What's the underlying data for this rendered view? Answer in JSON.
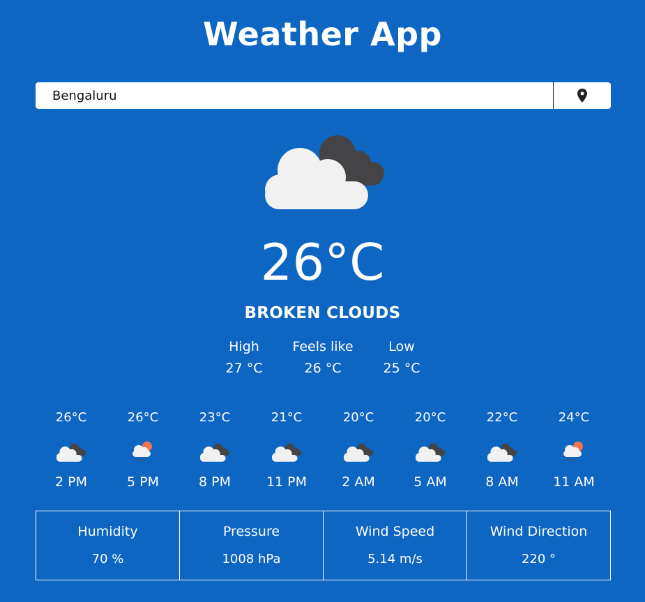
{
  "app": {
    "title": "Weather App"
  },
  "search": {
    "value": "Bengaluru"
  },
  "current": {
    "icon": "broken-clouds-icon",
    "temperature": "26°C",
    "description": "BROKEN CLOUDS",
    "stats": [
      {
        "label": "High",
        "value": "27 °C"
      },
      {
        "label": "Feels like",
        "value": "26 °C"
      },
      {
        "label": "Low",
        "value": "25 °C"
      }
    ]
  },
  "hourly": [
    {
      "temp": "26°C",
      "time": "2 PM",
      "icon": "broken-clouds-icon"
    },
    {
      "temp": "26°C",
      "time": "5 PM",
      "icon": "sun-cloud-rain-icon"
    },
    {
      "temp": "23°C",
      "time": "8 PM",
      "icon": "broken-clouds-icon"
    },
    {
      "temp": "21°C",
      "time": "11 PM",
      "icon": "broken-clouds-icon"
    },
    {
      "temp": "20°C",
      "time": "2 AM",
      "icon": "broken-clouds-icon"
    },
    {
      "temp": "20°C",
      "time": "5 AM",
      "icon": "broken-clouds-icon"
    },
    {
      "temp": "22°C",
      "time": "8 AM",
      "icon": "broken-clouds-icon"
    },
    {
      "temp": "24°C",
      "time": "11 AM",
      "icon": "sun-cloud-rain-icon"
    }
  ],
  "details": [
    {
      "label": "Humidity",
      "value": "70 %"
    },
    {
      "label": "Pressure",
      "value": "1008 hPa"
    },
    {
      "label": "Wind Speed",
      "value": "5.14 m/s"
    },
    {
      "label": "Wind Direction",
      "value": "220 °"
    }
  ],
  "colors": {
    "background": "#0c66c2",
    "cloud_light": "#f1f1f1",
    "cloud_dark": "#444446",
    "sun": "#f37350"
  }
}
